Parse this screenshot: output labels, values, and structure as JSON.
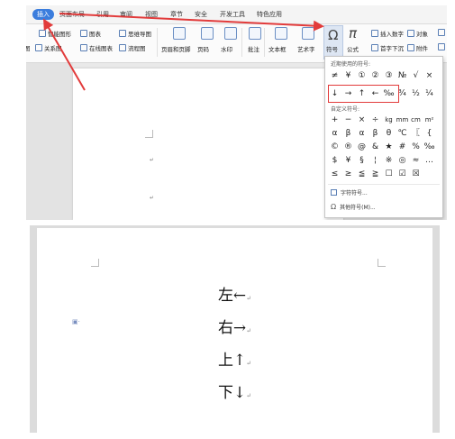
{
  "tabs": [
    "插入",
    "页面布局",
    "引用",
    "审阅",
    "视图",
    "章节",
    "安全",
    "开发工具",
    "特色应用"
  ],
  "ribbon": {
    "row1": [
      "智能图形",
      "图表",
      "思维导图"
    ],
    "row2_left": [
      "图",
      "关系图",
      "在线图表",
      "流程图"
    ],
    "big": [
      "页眉和页脚",
      "页码",
      "水印",
      "批注",
      "文本框",
      "艺术字",
      "符号",
      "公式"
    ],
    "right_top": [
      "插入数字",
      "对象"
    ],
    "right_bottom": [
      "首字下沉",
      "附件"
    ]
  },
  "symbol_dropdown": {
    "recent_title": "近期使用的符号:",
    "recent_row1": [
      "≠",
      "¥",
      "①",
      "②",
      "③",
      "№",
      "√",
      "×"
    ],
    "recent_row2": [
      "↓",
      "→",
      "↑",
      "←",
      "‰",
      "¾",
      "½",
      "¼"
    ],
    "custom_title": "自定义符号:",
    "custom_rows": [
      [
        "+",
        "−",
        "×",
        "÷",
        "kg",
        "mm",
        "cm",
        "m²"
      ],
      [
        "α",
        "β",
        "α",
        "β",
        "θ",
        "℃",
        "〖",
        "{"
      ],
      [
        "©",
        "®",
        "@",
        "&",
        "★",
        "#",
        "%",
        "‰"
      ],
      [
        "$",
        "¥",
        "§",
        "¦",
        "※",
        "◎",
        "≈",
        "…"
      ],
      [
        "≤",
        "≥",
        "≦",
        "≧",
        "☐",
        "☑",
        "☒",
        ""
      ]
    ],
    "more_item": "字符符号...",
    "other_item": "其他符号(M)..."
  },
  "bottom_doc": {
    "lines": [
      "左←",
      "右→",
      "上↑",
      "下↓"
    ],
    "para_mark": "↵"
  },
  "colors": {
    "accent": "#3b7ddd",
    "annotation": "#e23b3b"
  }
}
